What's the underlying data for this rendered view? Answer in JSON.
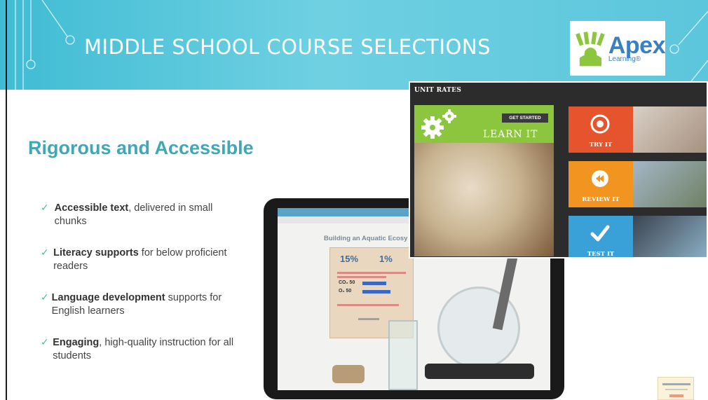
{
  "header": {
    "title": "MIDDLE SCHOOL COURSE SELECTIONS",
    "logo": {
      "name": "Apex",
      "sub": "Learning®"
    },
    "colors": {
      "band": "#5cc6dc",
      "title": "#ffffff"
    }
  },
  "content": {
    "headline": "Rigorous and Accessible",
    "bullets": [
      {
        "bold": "Accessible text",
        "rest": ", delivered in small chunks"
      },
      {
        "bold": "Literacy supports",
        "rest": " for below proficient readers"
      },
      {
        "bold": "Language development",
        "rest": " supports for English learners"
      },
      {
        "bold": "Engaging",
        "rest": ", high-quality instruction for all students"
      }
    ]
  },
  "tablet": {
    "lesson_title": "Building an Aquatic Ecosy",
    "stat_a": "15%",
    "stat_b": "1%",
    "row_a": "CO₂ 50",
    "row_b": "O₂ 50"
  },
  "unit_rates": {
    "header": "UNIT RATES",
    "get_started": "GET STARTED",
    "learn": "LEARN IT",
    "try": "TRY IT",
    "review": "REVIEW IT",
    "test": "TEST IT",
    "colors": {
      "learn": "#8cc63f",
      "try": "#e5542c",
      "review": "#f29420",
      "test": "#3aa0d8"
    }
  }
}
